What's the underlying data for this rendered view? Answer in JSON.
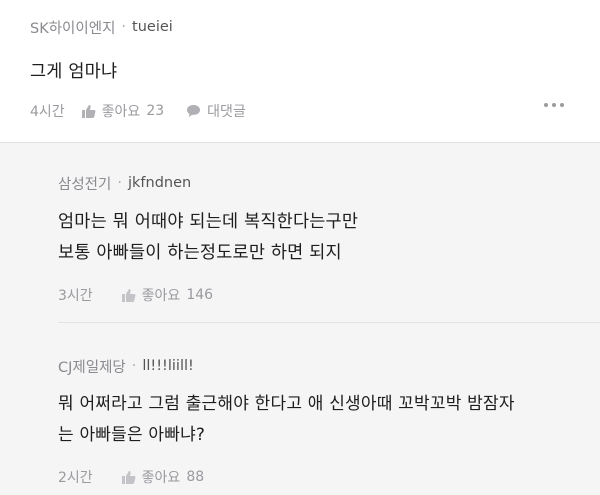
{
  "comments": [
    {
      "company": "SK하이이엔지",
      "separator": "·",
      "user": "tueiei",
      "lines": [
        "그게 엄마냐"
      ],
      "time": "4시간",
      "like_label": "좋아요",
      "like_count": "23",
      "reply_label": "대댓글"
    }
  ],
  "replies": [
    {
      "company": "삼성전기",
      "separator": "·",
      "user": "jkfndnen",
      "lines": [
        "엄마는 뭐 어때야 되는데 복직한다는구만",
        "보통 아빠들이 하는정도로만 하면 되지"
      ],
      "time": "3시간",
      "like_label": "좋아요",
      "like_count": "146"
    },
    {
      "company": "CJ제일제당",
      "separator": "·",
      "user": "ll!!!liill!",
      "lines": [
        "뭐 어쩌라고 그럼 출근해야 한다고 애 신생아때 꼬박꼬박 밤잠자",
        "는 아빠들은 아빠냐?"
      ],
      "time": "2시간",
      "like_label": "좋아요",
      "like_count": "88"
    }
  ],
  "colors": {
    "main_bg": "#ffffff",
    "reply_bg": "#f5f5f6",
    "meta": "#8a8a8f",
    "text": "#1e1e1e"
  },
  "icons": {
    "like": "thumbs-up-icon",
    "reply": "speech-bubble-icon",
    "more": "more-dots-icon"
  }
}
